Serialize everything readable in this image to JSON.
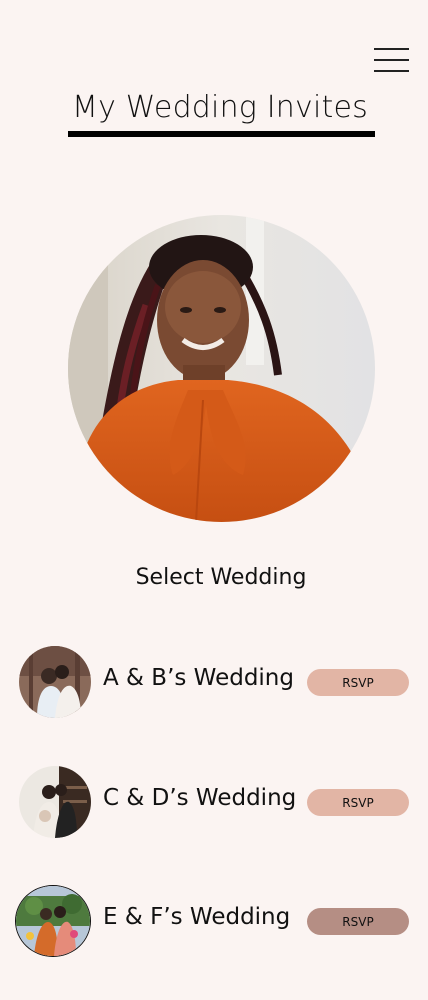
{
  "header": {
    "title": "My Wedding Invites",
    "menu_icon": "hamburger-menu-icon"
  },
  "profile": {
    "image": "profile-photo-woman-orange-blouse"
  },
  "select_label": "Select Wedding",
  "weddings": [
    {
      "name": "A & B’s Wedding",
      "rsvp_label": "RSVP",
      "avatar": "couple-photo-ab",
      "button_color": "#e2b5a5"
    },
    {
      "name": "C & D’s Wedding",
      "rsvp_label": "RSVP",
      "avatar": "couple-photo-cd",
      "button_color": "#e2b5a5"
    },
    {
      "name": "E & F’s Wedding",
      "rsvp_label": "RSVP",
      "avatar": "couple-photo-ef",
      "button_color": "#b58e84"
    }
  ],
  "colors": {
    "background": "#fbf4f2",
    "rsvp_default": "#e2b5a5",
    "rsvp_active": "#b58e84"
  }
}
